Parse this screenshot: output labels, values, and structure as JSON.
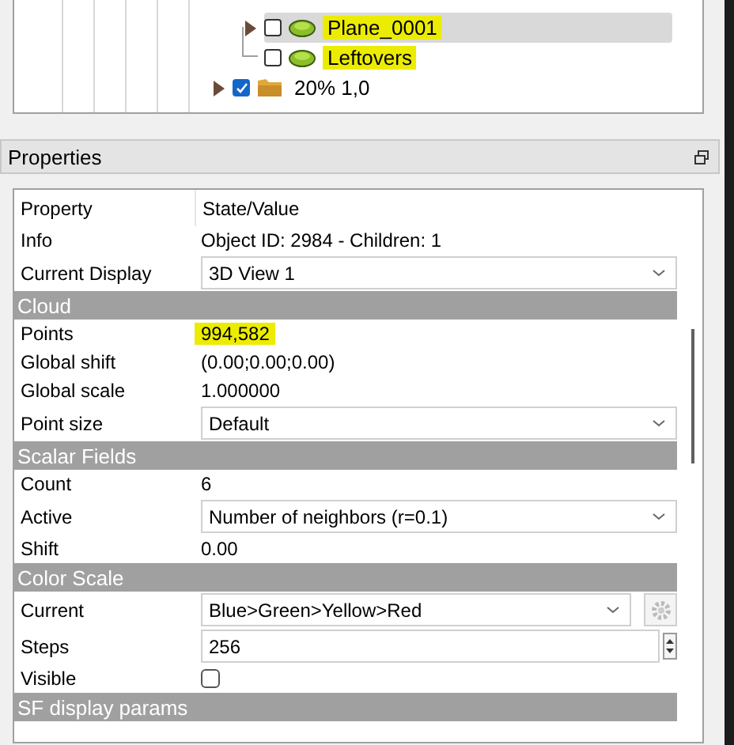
{
  "tree": {
    "items": [
      {
        "children": [
          {
            "label": "Plane_0001",
            "expandable": true,
            "checked": false,
            "selected": true,
            "highlighted": true,
            "kind": "cloud"
          },
          {
            "label": "Leftovers",
            "expandable": false,
            "checked": false,
            "selected": false,
            "highlighted": true,
            "kind": "cloud"
          }
        ]
      },
      {
        "label": "20% 1,0",
        "expandable": true,
        "checked": true,
        "selected": false,
        "highlighted": false,
        "kind": "folder"
      }
    ]
  },
  "properties": {
    "title": "Properties",
    "columns": [
      "Property",
      "State/Value"
    ],
    "rows": [
      {
        "kind": "text",
        "name": "Info",
        "value": "Object ID: 2984 - Children: 1"
      },
      {
        "kind": "combo",
        "name": "Current Display",
        "value": "3D View 1"
      },
      {
        "kind": "section",
        "name": "Cloud"
      },
      {
        "kind": "text",
        "name": "Points",
        "value": "994,582",
        "highlighted": true
      },
      {
        "kind": "text",
        "name": "Global shift",
        "value": "(0.00;0.00;0.00)"
      },
      {
        "kind": "text",
        "name": "Global scale",
        "value": "1.000000"
      },
      {
        "kind": "combo",
        "name": "Point size",
        "value": "Default"
      },
      {
        "kind": "section",
        "name": "Scalar Fields"
      },
      {
        "kind": "text",
        "name": "Count",
        "value": "6"
      },
      {
        "kind": "combo",
        "name": "Active",
        "value": "Number of neighbors (r=0.1)"
      },
      {
        "kind": "text",
        "name": "Shift",
        "value": "0.00"
      },
      {
        "kind": "section",
        "name": "Color Scale"
      },
      {
        "kind": "combo_gear",
        "name": "Current",
        "value": "Blue>Green>Yellow>Red"
      },
      {
        "kind": "spin",
        "name": "Steps",
        "value": "256"
      },
      {
        "kind": "check",
        "name": "Visible",
        "checked": false
      },
      {
        "kind": "section",
        "name": "SF display params"
      }
    ]
  }
}
